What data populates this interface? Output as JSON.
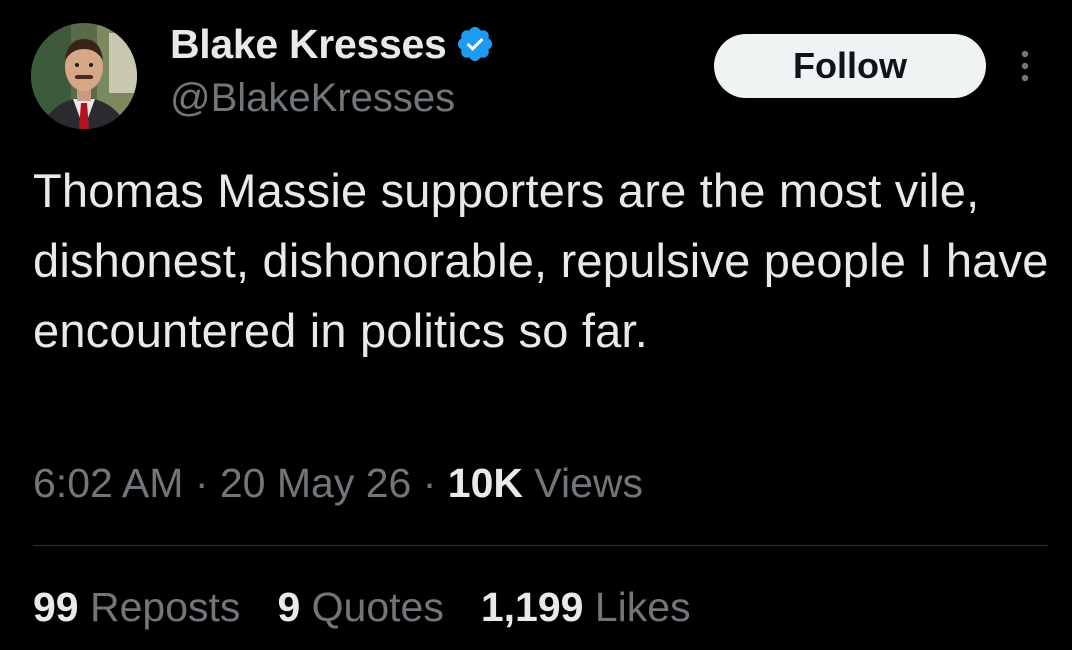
{
  "author": {
    "display_name": "Blake Kresses",
    "handle": "@BlakeKresses",
    "verified_icon": "verified-badge-icon",
    "verified_color": "#1d9bf0"
  },
  "actions": {
    "follow_label": "Follow",
    "more_icon": "more-vertical-icon"
  },
  "tweet": {
    "text": "Thomas Massie supporters are the most vile, dishonest, dishonorable, repulsive people I have encountered in politics so far."
  },
  "meta": {
    "time": "6:02 AM",
    "separator": " · ",
    "date": "20 May 26",
    "views_count": "10K",
    "views_label": "Views"
  },
  "stats": {
    "reposts_count": "99",
    "reposts_label": "Reposts",
    "quotes_count": "9",
    "quotes_label": "Quotes",
    "likes_count": "1,199",
    "likes_label": "Likes"
  },
  "colors": {
    "background": "#000000",
    "primary_text": "#e7e9ea",
    "secondary_text": "#71767b",
    "divider": "#2f3336",
    "follow_button_bg": "#eff3f4"
  }
}
